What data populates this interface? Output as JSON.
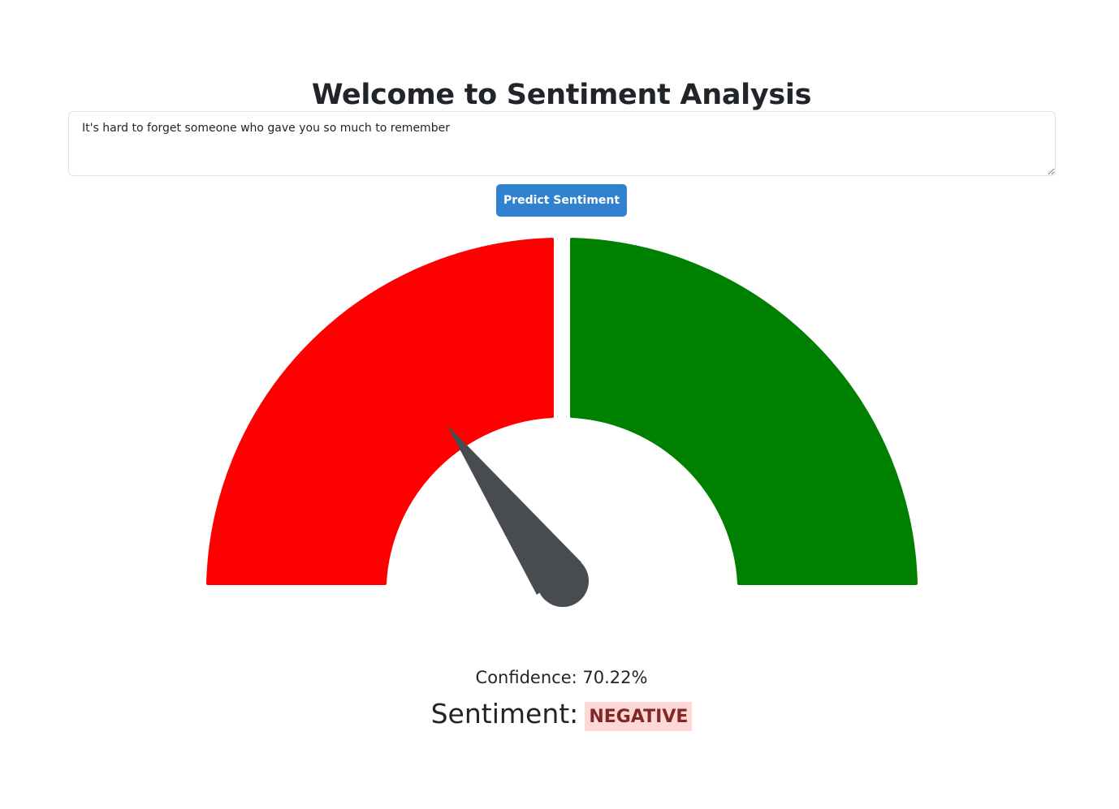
{
  "page": {
    "title": "Welcome to Sentiment Analysis"
  },
  "input": {
    "value": "It's hard to forget someone who gave you so much to remember"
  },
  "predict_button": {
    "label": "Predict Sentiment"
  },
  "gauge": {
    "segments": [
      {
        "sentiment": "negative",
        "color": "#ff0000"
      },
      {
        "sentiment": "positive",
        "color": "#008000"
      }
    ],
    "needle_color": "#484b50",
    "needle_value": 0.2978
  },
  "result": {
    "confidence_text": "Confidence: 70.22%",
    "sentiment_label": "Sentiment:",
    "sentiment_value": "NEGATIVE",
    "badge_text_color": "#822727",
    "badge_bg_color": "#fed7d7"
  }
}
